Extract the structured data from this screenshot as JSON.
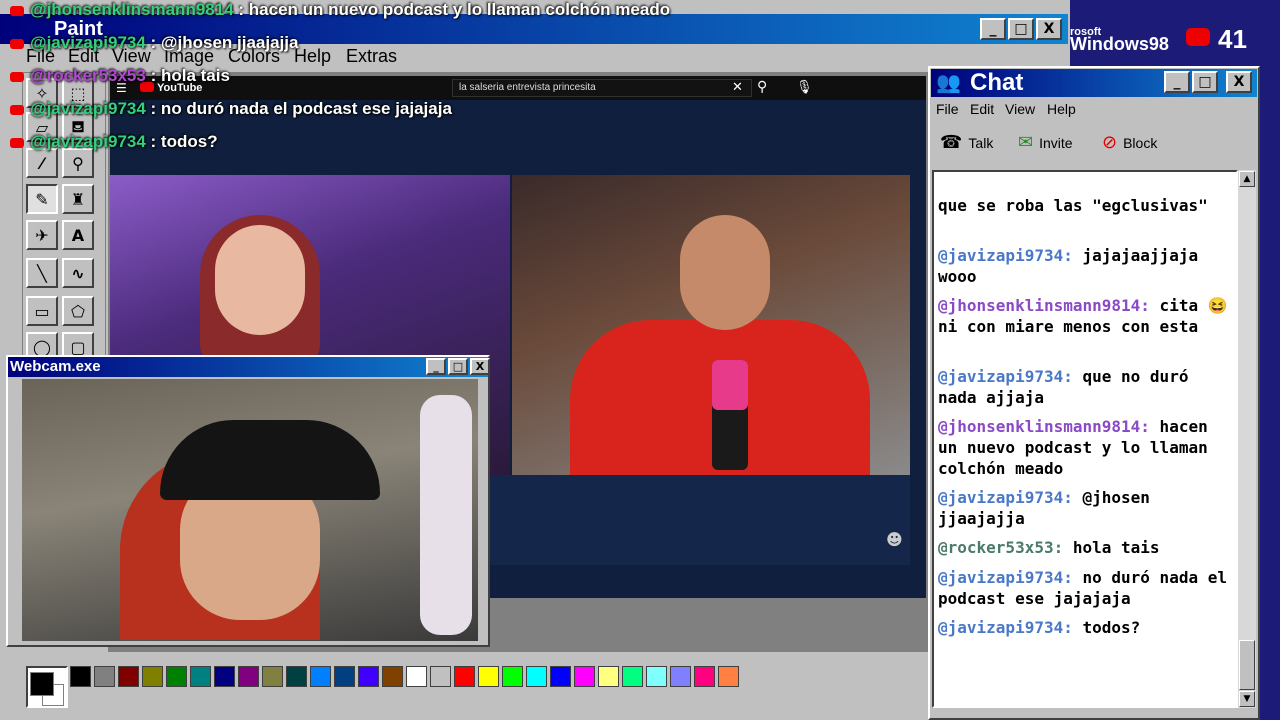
{
  "paint": {
    "title": "Paint",
    "menu": [
      "File",
      "Edit",
      "View",
      "Image",
      "Colors",
      "Help",
      "Extras"
    ],
    "window_buttons": [
      "_",
      "□",
      "X"
    ],
    "palette": [
      "#000000",
      "#808080",
      "#800000",
      "#808000",
      "#008000",
      "#008080",
      "#000080",
      "#800080",
      "#808040",
      "#004040",
      "#0080ff",
      "#004080",
      "#4000ff",
      "#804000",
      "#ffffff",
      "#c0c0c0",
      "#ff0000",
      "#ffff00",
      "#00ff00",
      "#00ffff",
      "#0000ff",
      "#ff00ff",
      "#ffff80",
      "#00ff80",
      "#80ffff",
      "#8080ff",
      "#ff0080",
      "#ff8040"
    ]
  },
  "youtube": {
    "logo": "YouTube",
    "search_value": "la salseria entrevista princesita"
  },
  "overlay_chat": [
    {
      "user": "@jhonsenklinsmann9814",
      "text": ": hacen un nuevo podcast y lo llaman colchón meado"
    },
    {
      "user": "@javizapi9734",
      "text": ": @jhosen jjaajajja"
    },
    {
      "user": "@rocker53x53",
      "text": ": hola tais"
    },
    {
      "user": "@javizapi9734",
      "text": ": no duró nada el podcast ese jajajaja"
    },
    {
      "user": "@javizapi9734",
      "text": ": todos?"
    }
  ],
  "webcam": {
    "title": "Webcam.exe"
  },
  "header": {
    "windows_logo": "Windows98",
    "microsoft_label": "rosoft",
    "subscriber_count": "41"
  },
  "chat": {
    "title": "Chat",
    "menu": [
      "File",
      "Edit",
      "View",
      "Help"
    ],
    "tools": [
      "Talk",
      "Invite",
      "Block"
    ],
    "messages": [
      {
        "user": "",
        "text": "que se roba las \"egclusivas\""
      },
      {
        "user": "@javizapi9734:",
        "text": " jajajaajjaja wooo"
      },
      {
        "user": "@jhonsenklinsmann9814:",
        "text": " cita 😆 ni con miare menos con esta"
      },
      {
        "user": "@javizapi9734:",
        "text": " que no duró nada ajjaja"
      },
      {
        "user": "@jhonsenklinsmann9814:",
        "text": " hacen un nuevo podcast y lo llaman colchón meado"
      },
      {
        "user": "@javizapi9734:",
        "text": " @jhosen jjaajajja"
      },
      {
        "user": "@rocker53x53:",
        "text": " hola tais"
      },
      {
        "user": "@javizapi9734:",
        "text": " no duró nada el podcast ese jajajaja"
      },
      {
        "user": "@javizapi9734:",
        "text": " todos?"
      }
    ]
  }
}
